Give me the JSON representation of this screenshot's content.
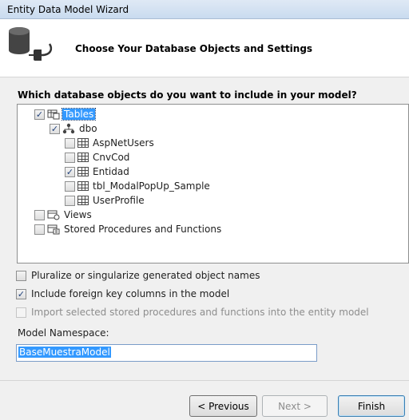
{
  "window": {
    "title": "Entity Data Model Wizard"
  },
  "header": {
    "heading": "Choose Your Database Objects and Settings",
    "icon": "database-plug-icon"
  },
  "objects_question": "Which database objects do you want to include in your model?",
  "tree": {
    "tables": {
      "label": "Tables",
      "checked": true,
      "selected": true
    },
    "dbo": {
      "label": "dbo",
      "checked": true
    },
    "items": [
      {
        "label": "AspNetUsers",
        "checked": false
      },
      {
        "label": "CnvCod",
        "checked": false
      },
      {
        "label": "Entidad",
        "checked": true
      },
      {
        "label": "tbl_ModalPopUp_Sample",
        "checked": false
      },
      {
        "label": "UserProfile",
        "checked": false
      }
    ],
    "views": {
      "label": "Views",
      "checked": false
    },
    "procs": {
      "label": "Stored Procedures and Functions",
      "checked": false
    }
  },
  "options": {
    "pluralize": {
      "label": "Pluralize or singularize generated object names",
      "checked": false
    },
    "foreign_keys": {
      "label": "Include foreign key columns in the model",
      "checked": true
    },
    "import_procs": {
      "label": "Import selected stored procedures and functions into the entity model",
      "checked": false,
      "disabled": true
    }
  },
  "namespace": {
    "label": "Model Namespace:",
    "value": "BaseMuestraModel"
  },
  "buttons": {
    "previous": "< Previous",
    "next": "Next >",
    "finish": "Finish"
  }
}
